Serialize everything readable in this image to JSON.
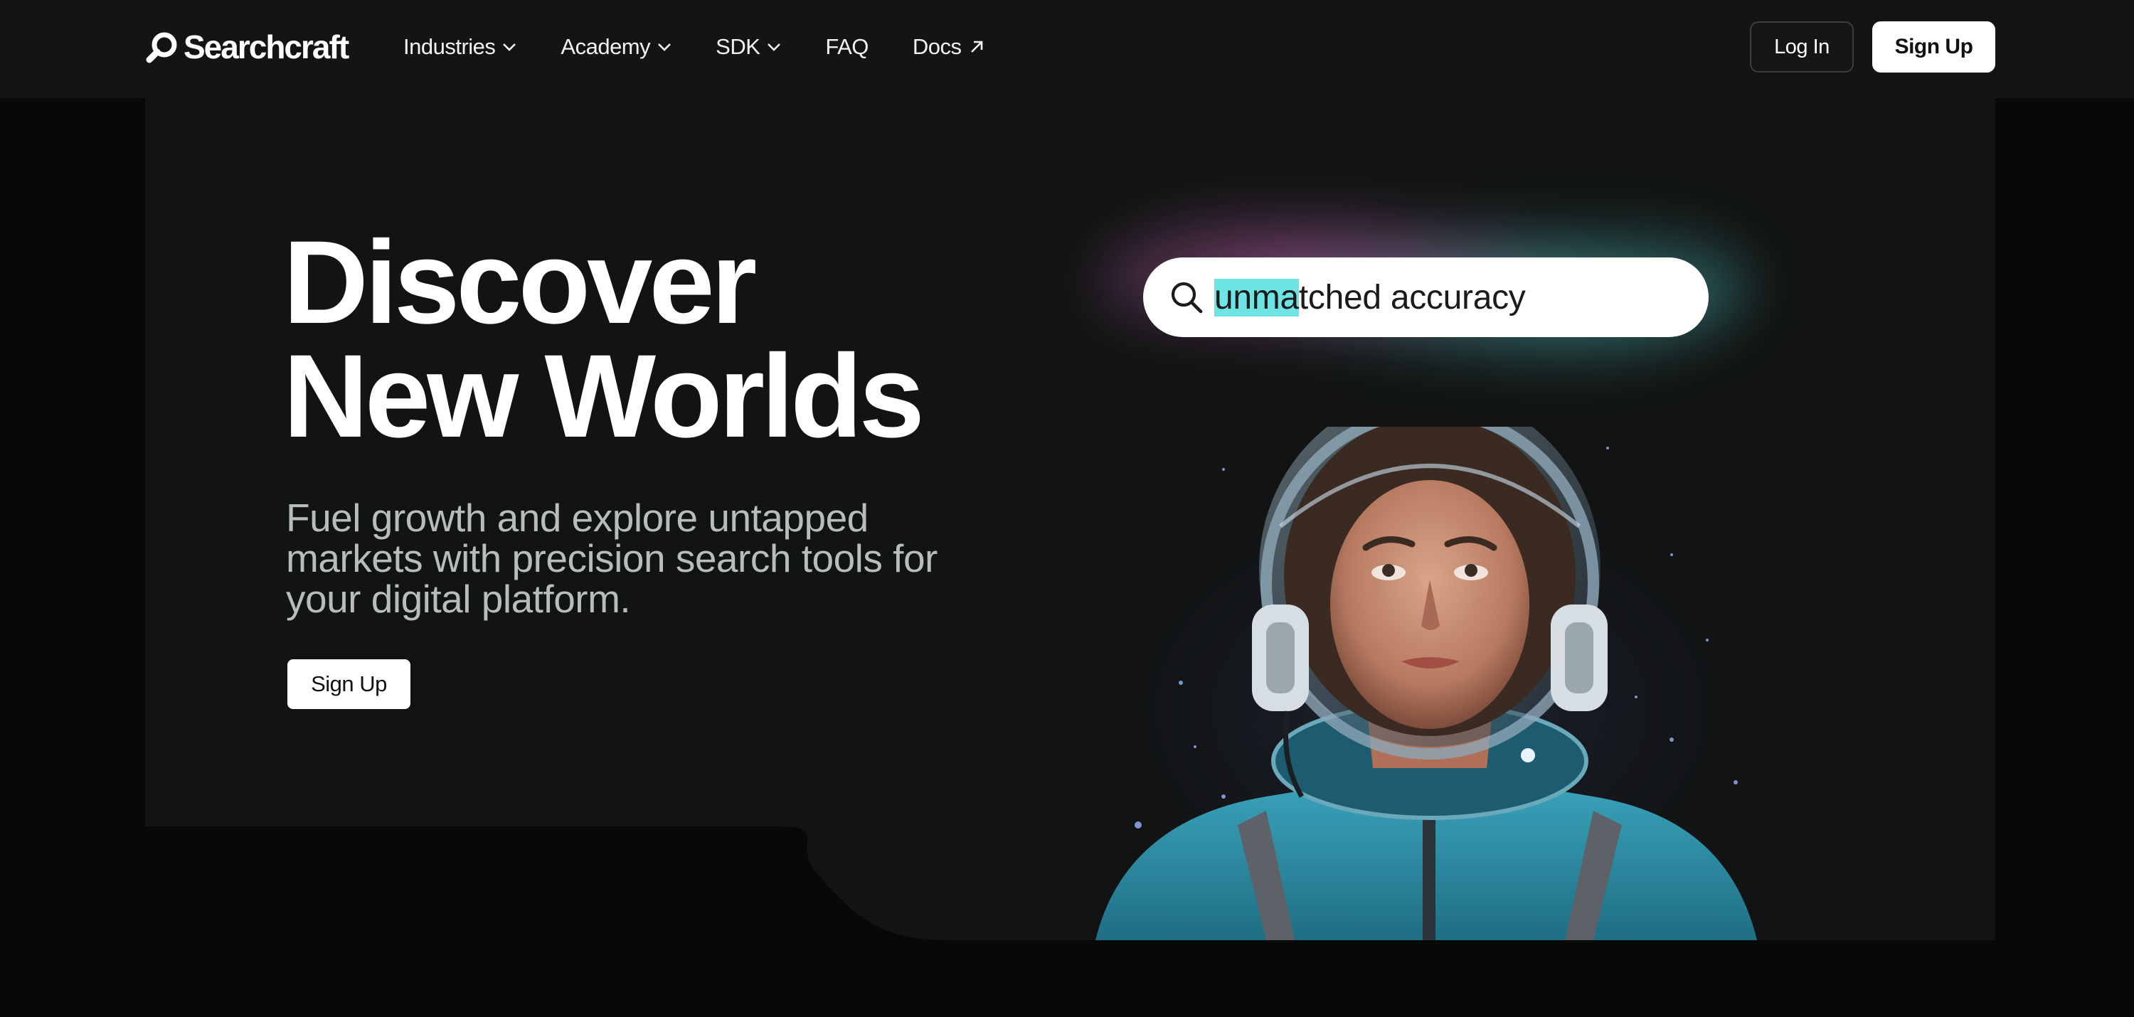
{
  "brand": {
    "name": "Searchcraft"
  },
  "nav": {
    "items": [
      {
        "label": "Industries",
        "icon": "chevron-down-icon"
      },
      {
        "label": "Academy",
        "icon": "chevron-down-icon"
      },
      {
        "label": "SDK",
        "icon": "chevron-down-icon"
      },
      {
        "label": "FAQ"
      },
      {
        "label": "Docs",
        "icon": "external-arrow-icon"
      }
    ],
    "login_label": "Log In",
    "signup_label": "Sign Up"
  },
  "hero": {
    "headline_line1": "Discover",
    "headline_line2": "New Worlds",
    "subheading": "Fuel growth and explore untapped markets with precision search tools for your digital platform.",
    "cta_label": "Sign Up"
  },
  "search_demo": {
    "highlighted": "unma",
    "rest": "tched accuracy",
    "icon": "search-icon"
  },
  "colors": {
    "nav_bg": "#131515",
    "panel_bg": "#121414",
    "page_bg": "#070808",
    "highlight": "#6fe4e4",
    "suit": "#2f8ea5"
  }
}
